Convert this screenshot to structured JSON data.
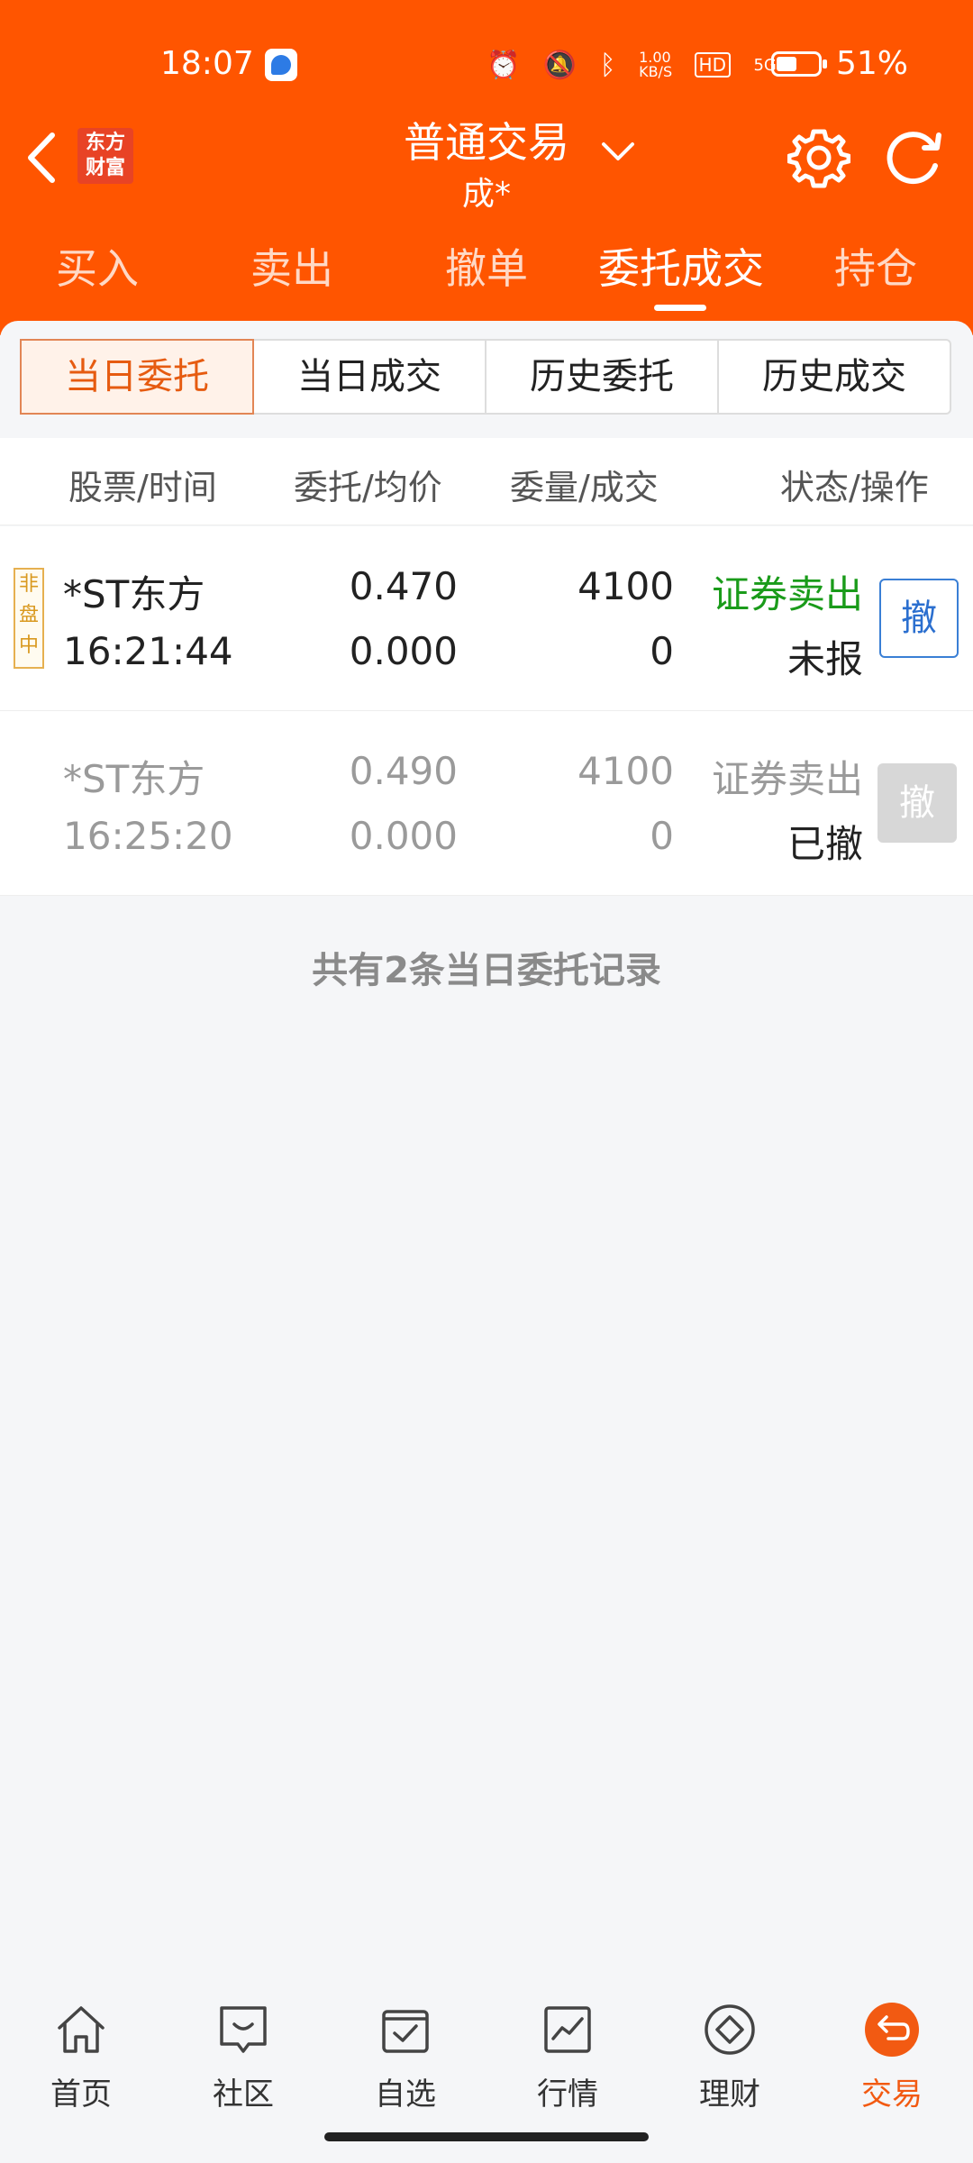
{
  "status_bar": {
    "time": "18:07",
    "net_speed": "1.00 KB/S",
    "hd": "HD",
    "network": "5G",
    "battery": "51%"
  },
  "header": {
    "logo_text": "东方财富",
    "title": "普通交易",
    "subtitle": "成*",
    "accent_color": "#ff5500"
  },
  "tabs": [
    {
      "label": "买入"
    },
    {
      "label": "卖出"
    },
    {
      "label": "撤单"
    },
    {
      "label": "委托成交",
      "active": true
    },
    {
      "label": "持仓"
    }
  ],
  "segments": [
    {
      "label": "当日委托",
      "active": true
    },
    {
      "label": "当日成交"
    },
    {
      "label": "历史委托"
    },
    {
      "label": "历史成交"
    }
  ],
  "columns": [
    "股票/时间",
    "委托/均价",
    "委量/成交",
    "状态/操作"
  ],
  "orders": [
    {
      "tag": "非盘中",
      "name": "*ST东方",
      "time": "16:21:44",
      "price": "0.470",
      "avg_price": "0.000",
      "qty": "4100",
      "filled": "0",
      "type": "证券卖出",
      "status": "未报",
      "action": "撤"
    },
    {
      "name": "*ST东方",
      "time": "16:25:20",
      "price": "0.490",
      "avg_price": "0.000",
      "qty": "4100",
      "filled": "0",
      "type": "证券卖出",
      "status": "已撤",
      "action": "撤"
    }
  ],
  "summary": "共有2条当日委托记录",
  "bottom_nav": [
    {
      "label": "首页",
      "icon": "home-icon"
    },
    {
      "label": "社区",
      "icon": "chat-icon"
    },
    {
      "label": "自选",
      "icon": "bag-check-icon"
    },
    {
      "label": "行情",
      "icon": "chart-icon"
    },
    {
      "label": "理财",
      "icon": "diamond-icon"
    },
    {
      "label": "交易",
      "icon": "exchange-icon",
      "active": true
    }
  ]
}
